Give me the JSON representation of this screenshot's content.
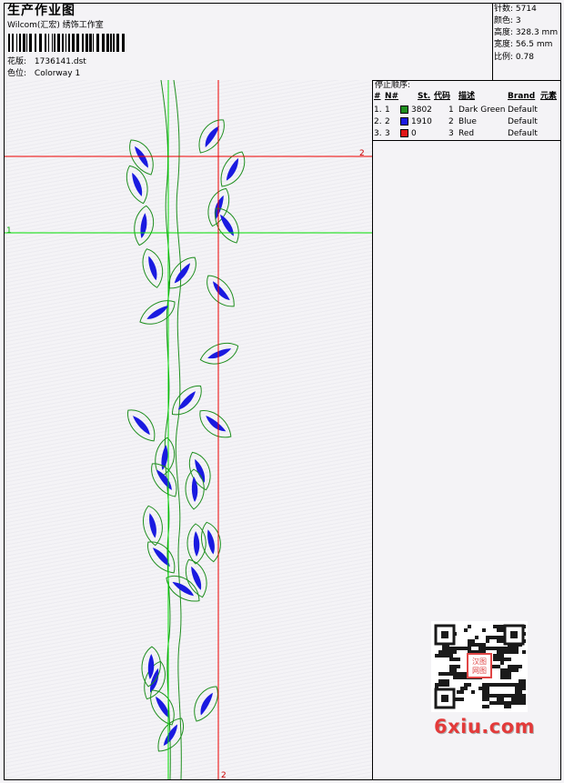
{
  "header": {
    "title": "生产作业图",
    "company": "Wilcom(汇宏) 绣饰工作室",
    "design_label": "花版:",
    "design_value": "1736141.dst",
    "colorway_label": "色位:",
    "colorway_value": "Colorway 1"
  },
  "stats": [
    {
      "label": "针数:",
      "value": "5714"
    },
    {
      "label": "颜色:",
      "value": "3"
    },
    {
      "label": "高度:",
      "value": "328.3 mm"
    },
    {
      "label": "宽度:",
      "value": "56.5 mm"
    },
    {
      "label": "比例:",
      "value": "0.78"
    }
  ],
  "stop_sequence": {
    "title": "停止顺序:",
    "columns": [
      "#",
      "N#",
      "St.",
      "代码",
      "描述",
      "Brand",
      "元素"
    ],
    "rows": [
      {
        "index": "1.",
        "n": "1",
        "color": "#1f8f1f",
        "stitches": "3802",
        "code": "1",
        "desc": "Dark Green",
        "brand": "Default"
      },
      {
        "index": "2.",
        "n": "2",
        "color": "#1a1ae0",
        "stitches": "1910",
        "code": "2",
        "desc": "Blue",
        "brand": "Default"
      },
      {
        "index": "3.",
        "n": "3",
        "color": "#e01818",
        "stitches": "0",
        "code": "3",
        "desc": "Red",
        "brand": "Default"
      }
    ]
  },
  "guides": {
    "h1_label": "1",
    "v1_label": "1",
    "h2_label": "2",
    "v2_label": "2",
    "green": "#00dd00",
    "red": "#ee0000"
  },
  "watermark": {
    "text": "6xiu.com",
    "qr_center": "汉图网图"
  }
}
